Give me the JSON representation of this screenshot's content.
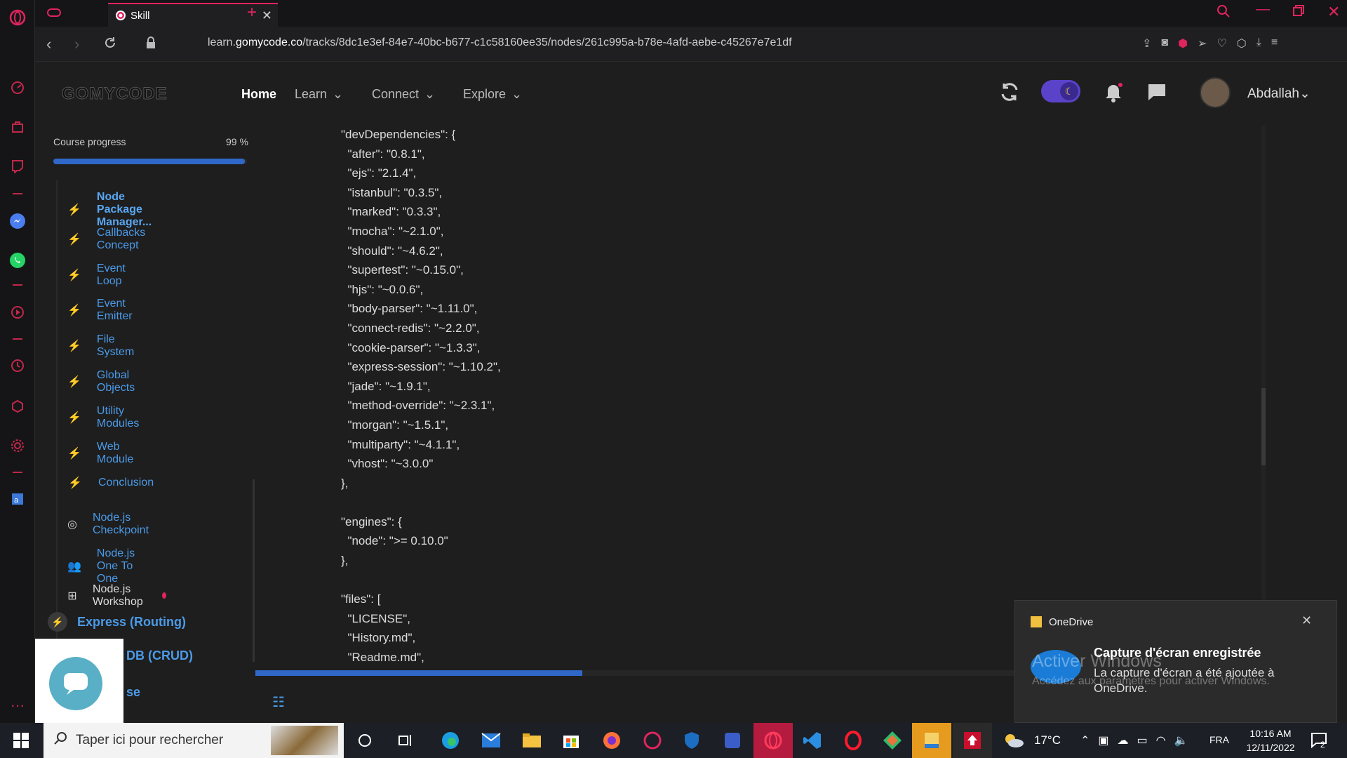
{
  "browser": {
    "tab_title": "Skill",
    "url_prefix": "learn.",
    "url_host": "gomycode.co",
    "url_path": "/tracks/8dc1e3ef-84e7-40bc-b677-c1c58160ee35/nodes/261c995a-b78e-4afd-aebe-c45267e7e1df"
  },
  "header": {
    "logo": "GOMYCODE",
    "nav": [
      "Home",
      "Learn",
      "Connect",
      "Explore"
    ],
    "username": "Abdallah"
  },
  "sidebar": {
    "progress_label": "Course progress",
    "progress_value": "99 %",
    "progress_fraction": 0.99,
    "lessons": [
      {
        "label": "Node Package Manager...",
        "icon": "bolt-icon",
        "state": "current"
      },
      {
        "label": "Callbacks Concept",
        "icon": "bolt-icon"
      },
      {
        "label": "Event Loop",
        "icon": "bolt-icon"
      },
      {
        "label": "Event Emitter",
        "icon": "bolt-icon"
      },
      {
        "label": "File System",
        "icon": "bolt-icon"
      },
      {
        "label": "Global Objects",
        "icon": "bolt-icon"
      },
      {
        "label": "Utility Modules",
        "icon": "bolt-icon"
      },
      {
        "label": "Web Module",
        "icon": "bolt-icon"
      },
      {
        "label": "Conclusion",
        "icon": "bolt-icon"
      },
      {
        "label": "Node.js Checkpoint",
        "icon": "target-icon"
      },
      {
        "label": "Node.js One To One",
        "icon": "people-icon"
      },
      {
        "label": "Node.js Workshop",
        "icon": "workshop-icon",
        "state": "muted"
      }
    ],
    "modules": [
      "Express (Routing)",
      "DB (CRUD)",
      "se"
    ]
  },
  "code_lines": [
    "\"devDependencies\": {",
    "  \"after\": \"0.8.1\",",
    "  \"ejs\": \"2.1.4\",",
    "  \"istanbul\": \"0.3.5\",",
    "  \"marked\": \"0.3.3\",",
    "  \"mocha\": \"~2.1.0\",",
    "  \"should\": \"~4.6.2\",",
    "  \"supertest\": \"~0.15.0\",",
    "  \"hjs\": \"~0.0.6\",",
    "  \"body-parser\": \"~1.11.0\",",
    "  \"connect-redis\": \"~2.2.0\",",
    "  \"cookie-parser\": \"~1.3.3\",",
    "  \"express-session\": \"~1.10.2\",",
    "  \"jade\": \"~1.9.1\",",
    "  \"method-override\": \"~2.3.1\",",
    "  \"morgan\": \"~1.5.1\",",
    "  \"multiparty\": \"~4.1.1\",",
    "  \"vhost\": \"~3.0.0\"",
    "},",
    "",
    "\"engines\": {",
    "  \"node\": \">= 0.10.0\"",
    "},",
    "",
    "\"files\": [",
    "  \"LICENSE\",",
    "  \"History.md\",",
    "  \"Readme.md\","
  ],
  "toast": {
    "app": "OneDrive",
    "title": "Capture d'écran enregistrée",
    "body": "La capture d'écran a été ajoutée à OneDrive.",
    "watermark_title": "Activer Windows",
    "watermark_sub": "Accédez aux paramètres pour activer Windows."
  },
  "taskbar": {
    "search_placeholder": "Taper ici pour rechercher",
    "weather": "17°C",
    "language": "FRA",
    "time": "10:16 AM",
    "date": "12/11/2022",
    "notifications": "2"
  },
  "colors": {
    "accent": "#2f68c8",
    "link": "#4b9ae8",
    "opera_red": "#e0245e"
  }
}
